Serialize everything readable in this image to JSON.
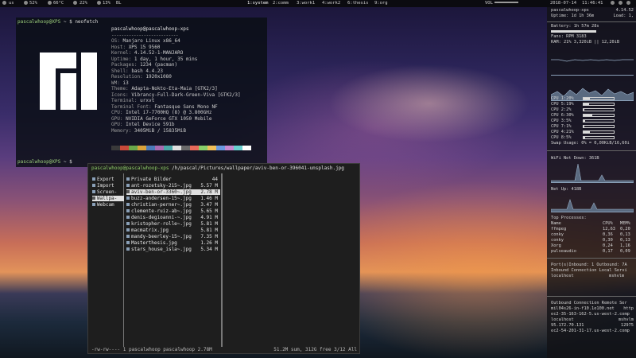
{
  "topbar": {
    "left_items": [
      "us",
      "52%",
      "66°C",
      "22%",
      "13%",
      "BL"
    ],
    "workspaces": [
      "1:system",
      "2:comm",
      "3:work1",
      "4:work2",
      "6:thesis",
      "9:org"
    ],
    "right_items": [
      "VOL",
      "2018-07-14",
      "11:46:41"
    ]
  },
  "neofetch": {
    "prompt_user": "pascalwhoop@XPS",
    "prompt_path": "~",
    "prompt_symbol": "$",
    "command": "neofetch",
    "user_host": "pascalwhoop@pascalwhoop-xps",
    "separator": "---------------------------",
    "info": [
      {
        "key": "OS:",
        "value": "Manjaro Linux x86_64"
      },
      {
        "key": "Host:",
        "value": "XPS 15 9560"
      },
      {
        "key": "Kernel:",
        "value": "4.14.52-1-MANJARO"
      },
      {
        "key": "Uptime:",
        "value": "1 day, 1 hour, 35 mins"
      },
      {
        "key": "Packages:",
        "value": "1234 (pacman)"
      },
      {
        "key": "Shell:",
        "value": "bash 4.4.23"
      },
      {
        "key": "Resolution:",
        "value": "1920x1080"
      },
      {
        "key": "WM:",
        "value": "i3"
      },
      {
        "key": "Theme:",
        "value": "Adapta-Nokto-Eta-Maia [GTK2/3]"
      },
      {
        "key": "Icons:",
        "value": "Vibrancy-Full-Dark-Green-Viva [GTK2/3]"
      },
      {
        "key": "Terminal:",
        "value": "urxvt"
      },
      {
        "key": "Terminal Font:",
        "value": "Fantasque Sans Mono NF"
      },
      {
        "key": "CPU:",
        "value": "Intel i7-7700HQ (8) @ 3.800GHz"
      },
      {
        "key": "GPU:",
        "value": "NVIDIA GeForce GTX 1050 Mobile"
      },
      {
        "key": "GPU:",
        "value": "Intel Device 591b"
      },
      {
        "key": "Memory:",
        "value": "3405MiB / 15835MiB"
      }
    ],
    "swatch_colors": [
      "#3a3a3a",
      "#c84a3a",
      "#6aa84a",
      "#d8a23a",
      "#4a7ab8",
      "#a86ab0",
      "#4aa8a8",
      "#e0e0e0",
      "#6a6a6a",
      "#e86a5a",
      "#8ad06a",
      "#f0c05a",
      "#6a9ae0",
      "#c88ad0",
      "#6ad0d0",
      "#ffffff"
    ],
    "second_prompt_user": "pascalwhoop@XPS",
    "second_prompt_path": "~",
    "second_prompt_symbol": "$"
  },
  "ranger": {
    "title_user": "pascalwhoop@pascalwhoop-xps",
    "title_path": "/h/pascal/Pictures/wallpaper/aviv-ben-or-396041-unsplash.jpg",
    "parent_items": [
      "Export",
      "Import",
      "Screen-",
      "Wallpa-",
      "Webcam"
    ],
    "parent_selected": 3,
    "current_header": {
      "name": "Private Bilder",
      "count": "44"
    },
    "files": [
      {
        "name": "ant-rozetsky-215~.jpg",
        "size": "5.57 M"
      },
      {
        "name": "aviv-ben-or-3360~.jpg",
        "size": "2.78 M"
      },
      {
        "name": "buzz-andersen-15~.jpg",
        "size": "1.46 M"
      },
      {
        "name": "christian-perner~.jpg",
        "size": "3.47 M"
      },
      {
        "name": "clemente-ruiz-ab~.jpg",
        "size": "5.65 M"
      },
      {
        "name": "denis-degioanni-~.jpg",
        "size": "4.91 M"
      },
      {
        "name": "kristopher-rolle~.jpg",
        "size": "5.81 M"
      },
      {
        "name": "macmatrix.jpg",
        "size": "5.81 M"
      },
      {
        "name": "mandy-beerley-15~.jpg",
        "size": "7.35 M"
      },
      {
        "name": "Masterthesis.jpg",
        "size": "1.26 M"
      },
      {
        "name": "stars_house_isla~.jpg",
        "size": "5.34 M"
      }
    ],
    "selected_file": 1,
    "status_left": "-rw-rw---- 1 pascalwhoop pascalwhoop 2.78M",
    "status_right": "51.2M sum, 312G free  3/12  All"
  },
  "conky": {
    "host": "pascalwhoop-xps",
    "kernel": "4.14.52",
    "uptime": "Uptime: 1d 1h 36m",
    "load": "Load: 1,",
    "battery": "Battery: 1h 57m 28s",
    "battery_level": 0.55,
    "fans": "Fans: RPM 3183",
    "ram": "RAM: 21% 3,320iB  || 12,20iB",
    "ram_level": 0.21,
    "cpus": [
      {
        "label": "CPU 1:20%",
        "level": 0.2
      },
      {
        "label": "CPU 5:19%",
        "level": 0.19
      },
      {
        "label": "CPU 2:2%",
        "level": 0.02
      },
      {
        "label": "CPU 6:30%",
        "level": 0.3
      },
      {
        "label": "CPU 3:5%",
        "level": 0.05
      },
      {
        "label": "CPU 7:1%",
        "level": 0.01
      },
      {
        "label": "CPU 4:21%",
        "level": 0.21
      },
      {
        "label": "CPU 8:5%",
        "level": 0.05
      }
    ],
    "swap": "Swap Usage: 0% = 0,00KiB/16,60i",
    "wifi_down": "WiFi Net Down: 361B",
    "net_up": "Net Up: 418B",
    "top_title": "Top Processes:",
    "top_header": {
      "name": "Name",
      "cpu": "CPU%",
      "mem": "MEM%"
    },
    "processes": [
      {
        "name": "ffmpeg",
        "cpu": "12,63",
        "mem": "0,20"
      },
      {
        "name": "conky",
        "cpu": "0,36",
        "mem": "0,13"
      },
      {
        "name": "conky",
        "cpu": "0,30",
        "mem": "0,13"
      },
      {
        "name": "Xorg",
        "cpu": "0,24",
        "mem": "1,16"
      },
      {
        "name": "pulseaudio",
        "cpu": "0,17",
        "mem": "0,09"
      }
    ],
    "ports": "Port(s)Inbound: 1  Outbound: 7A",
    "inbound_header": "Inbound Connection  Local Servi",
    "inbound_row": {
      "host": "localhost",
      "service": "mshvlm"
    },
    "outbound_header": "Outbound Connection  Remote Ser",
    "outbound_rows": [
      {
        "host": "mil04s26-in-f10.1e100.net",
        "port": "http"
      },
      {
        "host": "ec2-35-163-162-5.us-west-2.comp",
        "port": ""
      },
      {
        "host": "localhost",
        "port": "mshvlm"
      },
      {
        "host": "95.172.70.131",
        "port": "12975"
      },
      {
        "host": "ec2-54-201-31-17.us-west-2.comp",
        "port": ""
      }
    ]
  }
}
